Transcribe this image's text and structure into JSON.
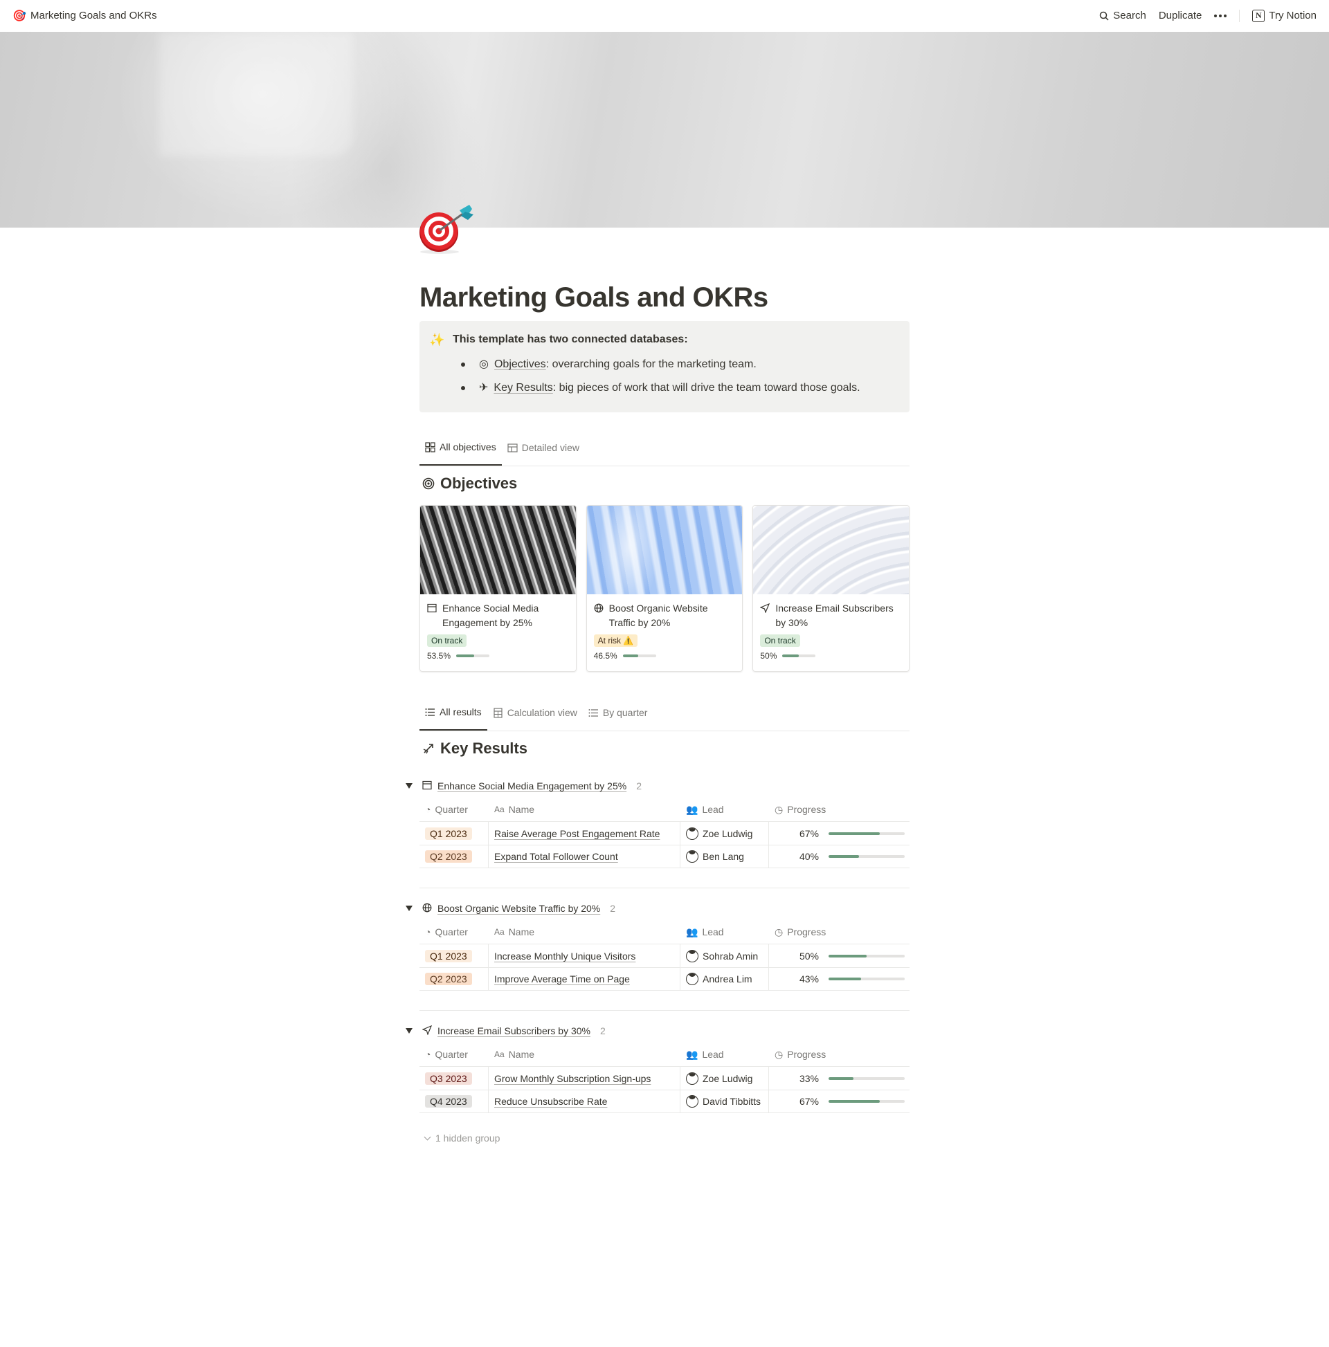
{
  "topbar": {
    "page_title": "Marketing Goals and OKRs",
    "page_icon": "dart-target-emoji",
    "search_label": "Search",
    "duplicate_label": "Duplicate",
    "try_notion_label": "Try Notion"
  },
  "page": {
    "title": "Marketing Goals and OKRs"
  },
  "callout": {
    "icon": "sparkles-icon",
    "heading": "This template has two connected databases:",
    "items": [
      {
        "icon": "target-icon",
        "link": "Objectives",
        "text": ": overarching goals for the marketing team."
      },
      {
        "icon": "dart-icon",
        "link": "Key Results",
        "text": ": big pieces of work that will drive the team toward those goals."
      }
    ]
  },
  "objectives_tabs": [
    {
      "label": "All objectives",
      "icon": "gallery-icon",
      "active": true
    },
    {
      "label": "Detailed view",
      "icon": "table-icon",
      "active": false
    }
  ],
  "objectives": {
    "title": "Objectives",
    "cards": [
      {
        "title": "Enhance Social Media Engagement by 25%",
        "icon": "browser-icon",
        "status": "On track",
        "status_type": "ok",
        "progress_label": "53.5%",
        "progress": 0.535
      },
      {
        "title": "Boost Organic Website Traffic by 20%",
        "icon": "globe-icon",
        "status": "At risk ⚠️",
        "status_type": "risk",
        "progress_label": "46.5%",
        "progress": 0.465
      },
      {
        "title": "Increase Email Subscribers by 30%",
        "icon": "send-icon",
        "status": "On track",
        "status_type": "ok",
        "progress_label": "50%",
        "progress": 0.5
      }
    ]
  },
  "results_tabs": [
    {
      "label": "All results",
      "icon": "list-icon",
      "active": true
    },
    {
      "label": "Calculation view",
      "icon": "calculator-icon",
      "active": false
    },
    {
      "label": "By quarter",
      "icon": "list-icon",
      "active": false
    }
  ],
  "key_results": {
    "title": "Key Results",
    "columns": {
      "quarter": "Quarter",
      "name": "Name",
      "lead": "Lead",
      "progress": "Progress"
    },
    "groups": [
      {
        "title": "Enhance Social Media Engagement by 25%",
        "icon": "browser-icon",
        "count": "2",
        "rows": [
          {
            "quarter": "Q1 2023",
            "quarter_color": "#fbecdd",
            "quarter_text": "#49290e",
            "name": "Raise Average Post Engagement Rate",
            "lead": "Zoe Ludwig",
            "progress_label": "67%",
            "progress": 0.67
          },
          {
            "quarter": "Q2 2023",
            "quarter_color": "#fadec9",
            "quarter_text": "#5c3b23",
            "name": "Expand Total Follower Count",
            "lead": "Ben Lang",
            "progress_label": "40%",
            "progress": 0.4
          }
        ]
      },
      {
        "title": "Boost Organic Website Traffic by 20%",
        "icon": "globe-icon",
        "count": "2",
        "rows": [
          {
            "quarter": "Q1 2023",
            "quarter_color": "#fbecdd",
            "quarter_text": "#49290e",
            "name": "Increase Monthly Unique Visitors",
            "lead": "Sohrab Amin",
            "progress_label": "50%",
            "progress": 0.5
          },
          {
            "quarter": "Q2 2023",
            "quarter_color": "#fadec9",
            "quarter_text": "#5c3b23",
            "name": "Improve Average Time on Page",
            "lead": "Andrea Lim",
            "progress_label": "43%",
            "progress": 0.43
          }
        ]
      },
      {
        "title": "Increase Email Subscribers by 30%",
        "icon": "send-icon",
        "count": "2",
        "rows": [
          {
            "quarter": "Q3 2023",
            "quarter_color": "#f4dfd9",
            "quarter_text": "#5d1715",
            "name": "Grow Monthly Subscription Sign-ups",
            "lead": "Zoe Ludwig",
            "progress_label": "33%",
            "progress": 0.33
          },
          {
            "quarter": "Q4 2023",
            "quarter_color": "#e3e2e0",
            "quarter_text": "#32302c",
            "name": "Reduce Unsubscribe Rate",
            "lead": "David Tibbitts",
            "progress_label": "67%",
            "progress": 0.67
          }
        ]
      }
    ],
    "hidden_group_label": "1 hidden group"
  },
  "colors": {
    "progress_fill": "#6c9b7d",
    "callout_bg": "#f1f1ef",
    "text": "#37352f"
  }
}
